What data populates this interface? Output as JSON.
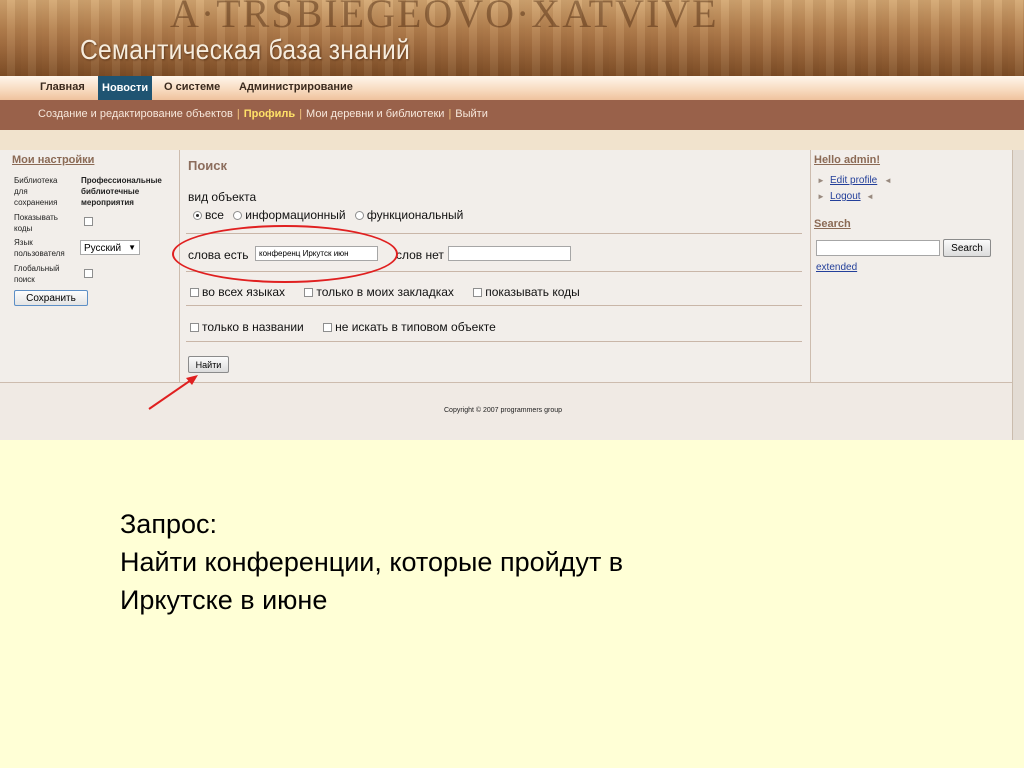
{
  "banner": {
    "title": "Семантическая база знаний",
    "decorative_text": "A·TRSBIEGEOVO·XATVIVE"
  },
  "main_menu": {
    "items": [
      {
        "label": "Главная",
        "active": false
      },
      {
        "label": "Новости",
        "active": true
      },
      {
        "label": "О системе",
        "active": false
      },
      {
        "label": "Администрирование",
        "active": false
      }
    ]
  },
  "sub_menu": {
    "items": [
      {
        "label": "Создание и редактирование объектов",
        "current": false
      },
      {
        "label": "Профиль",
        "current": true
      },
      {
        "label": "Мои деревни и библиотеки",
        "current": false
      },
      {
        "label": "Выйти",
        "current": false
      }
    ]
  },
  "settings": {
    "title": "Мои настройки",
    "library_label": "Библиотека для сохранения",
    "library_value": "Профессиональные библиотечные мероприятия",
    "show_codes_label": "Показывать коды",
    "show_codes_checked": false,
    "language_label": "Язык пользователя",
    "language_value": "Русский",
    "global_search_label": "Глобальный поиск",
    "global_search_checked": false,
    "save_button": "Сохранить"
  },
  "search_form": {
    "title": "Поиск",
    "object_kind_label": "вид объекта",
    "radio_options": [
      {
        "label": "все",
        "selected": true
      },
      {
        "label": "информационный",
        "selected": false
      },
      {
        "label": "функциональный",
        "selected": false
      }
    ],
    "words_present_label": "слова есть",
    "words_present_value": "конференц Иркутск июн",
    "words_absent_label": "слов нет",
    "words_absent_value": "",
    "checkboxes_row1": [
      {
        "label": "во всех языках",
        "checked": false
      },
      {
        "label": "только в моих закладках",
        "checked": false
      },
      {
        "label": "показывать коды",
        "checked": false
      }
    ],
    "checkboxes_row2": [
      {
        "label": "только в названии",
        "checked": false
      },
      {
        "label": "не искать в типовом объекте",
        "checked": false
      }
    ],
    "find_button": "Найти"
  },
  "user_panel": {
    "greeting": "Hello admin!",
    "links": [
      "Edit profile",
      "Logout"
    ],
    "search_title": "Search",
    "search_value": "",
    "search_button": "Search",
    "extended_link": "extended"
  },
  "footer": {
    "copyright": "Copyright © 2007 programmers group"
  },
  "caption": {
    "line1": "Запрос:",
    "line2": "Найти конференции, которые пройдут в",
    "line3": "Иркутске в июне"
  },
  "colors": {
    "active_menu": "#1f5472",
    "sub_menu_bg": "#99614a",
    "current_sub_item": "#ffe168",
    "link": "#233f9a",
    "annotation": "#e02020",
    "slide_bg": "#ffffd6"
  },
  "icons": [
    "radio-selected-icon",
    "radio-icon",
    "checkbox-icon",
    "dropdown-arrow-icon",
    "right-triangle-icon",
    "left-triangle-icon",
    "annotation-arrow-icon"
  ]
}
